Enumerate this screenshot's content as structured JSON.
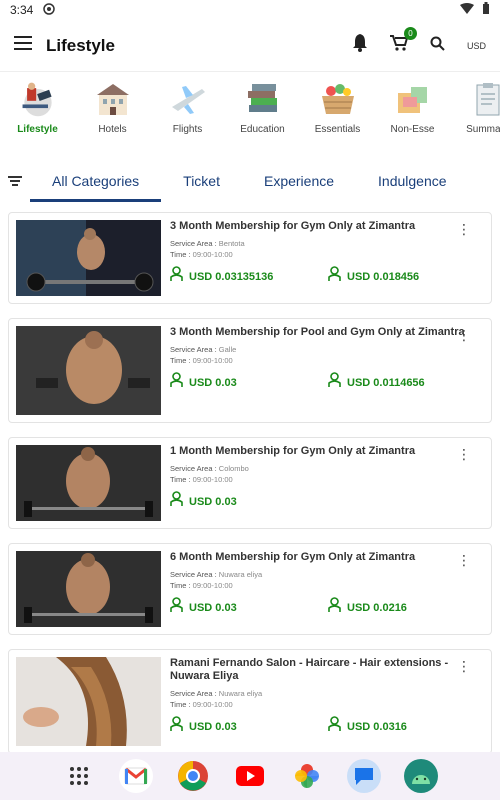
{
  "status": {
    "time": "3:34"
  },
  "appbar": {
    "title": "Lifestyle",
    "cart_count": "0",
    "currency": "USD"
  },
  "categories": [
    {
      "label": "Lifestyle",
      "icon": "lifestyle-icon"
    },
    {
      "label": "Hotels",
      "icon": "hotel-icon"
    },
    {
      "label": "Flights",
      "icon": "airplane-icon"
    },
    {
      "label": "Education",
      "icon": "books-icon"
    },
    {
      "label": "Essentials",
      "icon": "basket-icon"
    },
    {
      "label": "Non-Esse",
      "icon": "gift-icon"
    },
    {
      "label": "Summary",
      "icon": "clipboard-icon"
    }
  ],
  "tabs": [
    "All Categories",
    "Ticket",
    "Experience",
    "Indulgence"
  ],
  "labels": {
    "service_area": "Service Area :",
    "time": "Time :"
  },
  "items": [
    {
      "title": "3 Month Membership for Gym Only at Zimantra",
      "service_area": "Bentota",
      "time": "09:00-10:00",
      "price_1": "USD 0.03135136",
      "price_2": "USD 0.018456"
    },
    {
      "title": "3 Month Membership for Pool and Gym Only at Zimantra",
      "service_area": "Galle",
      "time": "09:00-10:00",
      "price_1": "USD 0.03",
      "price_2": "USD 0.0114656"
    },
    {
      "title": "1 Month Membership for Gym Only at Zimantra",
      "service_area": "Colombo",
      "time": "09:00-10:00",
      "price_1": "USD 0.03",
      "price_2": ""
    },
    {
      "title": "6 Month Membership for Gym Only at Zimantra",
      "service_area": "Nuwara eliya",
      "time": "09:00-10:00",
      "price_1": "USD 0.03",
      "price_2": "USD 0.0216"
    },
    {
      "title": "Ramani Fernando Salon - Haircare - Hair extensions - Nuwara Eliya",
      "service_area": "Nuwara eliya",
      "time": "09:00-10:00",
      "price_1": "USD 0.03",
      "price_2": "USD 0.0316"
    }
  ],
  "colors": {
    "accent_green": "#1a8a1a",
    "tab_blue": "#1a3f7a"
  },
  "dock": [
    "apps-icon",
    "gmail-icon",
    "chrome-icon",
    "youtube-icon",
    "photos-icon",
    "messages-icon",
    "android-icon"
  ]
}
